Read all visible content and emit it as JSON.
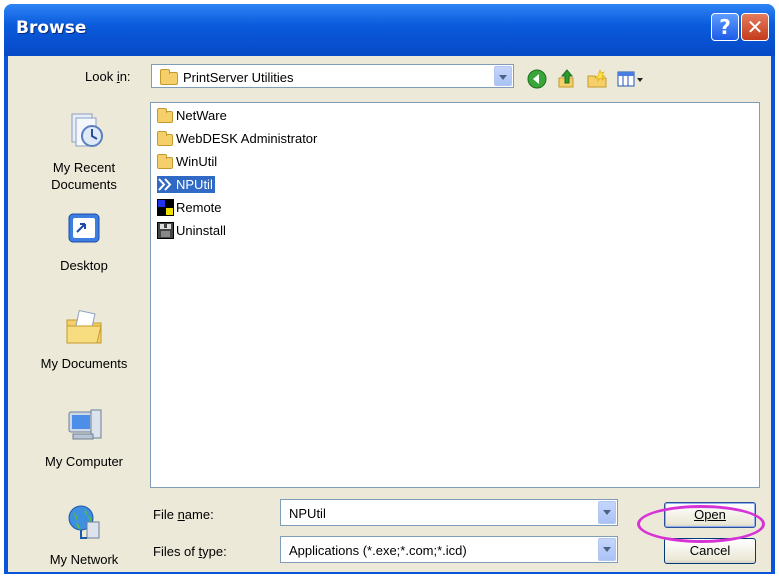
{
  "window": {
    "title": "Browse",
    "help_glyph": "?",
    "close_glyph": "✕"
  },
  "lookin": {
    "label": "Look in:",
    "value": "PrintServer Utilities"
  },
  "toolbar": {
    "icons": [
      "back-icon",
      "up-folder-icon",
      "new-folder-icon",
      "view-menu-icon"
    ]
  },
  "places": [
    {
      "label_line1": "My Recent",
      "label_line2": "Documents",
      "icon": "recent-documents-icon"
    },
    {
      "label_line1": "Desktop",
      "label_line2": "",
      "icon": "desktop-icon"
    },
    {
      "label_line1": "My Documents",
      "label_line2": "",
      "icon": "my-documents-icon"
    },
    {
      "label_line1": "My Computer",
      "label_line2": "",
      "icon": "my-computer-icon"
    },
    {
      "label_line1": "My Network",
      "label_line2": "",
      "icon": "my-network-icon"
    }
  ],
  "files": [
    {
      "name": "NetWare",
      "type": "folder"
    },
    {
      "name": "WebDESK Administrator",
      "type": "folder"
    },
    {
      "name": "WinUtil",
      "type": "folder"
    },
    {
      "name": "NPUtil",
      "type": "application",
      "selected": true
    },
    {
      "name": "Remote",
      "type": "application"
    },
    {
      "name": "Uninstall",
      "type": "application"
    }
  ],
  "filename": {
    "label": "File name:",
    "value": "NPUtil"
  },
  "filetype": {
    "label": "Files of type:",
    "value": "Applications (*.exe;*.com;*.icd)"
  },
  "buttons": {
    "open": "Open",
    "cancel": "Cancel"
  },
  "colors": {
    "titlebar": "#0a54d9",
    "selection": "#316ac5",
    "highlight_ring": "#d633d6"
  }
}
